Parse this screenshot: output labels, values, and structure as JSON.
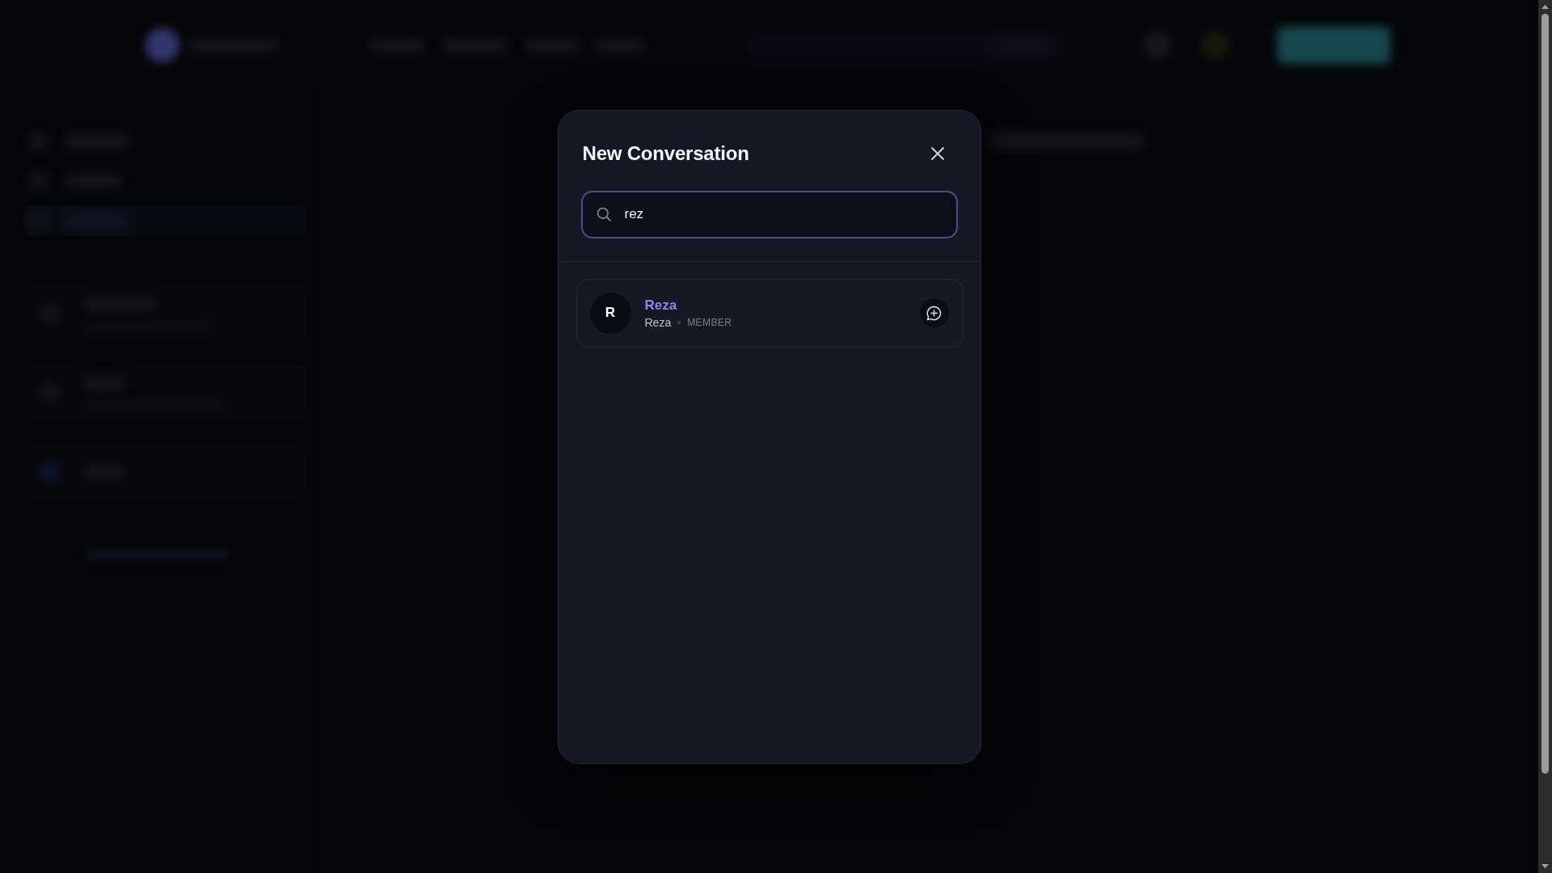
{
  "dialog": {
    "title": "New Conversation",
    "search": {
      "value": "rez"
    },
    "results": [
      {
        "initial": "R",
        "name": "Reza",
        "username": "Reza",
        "role": "MEMBER"
      }
    ]
  }
}
